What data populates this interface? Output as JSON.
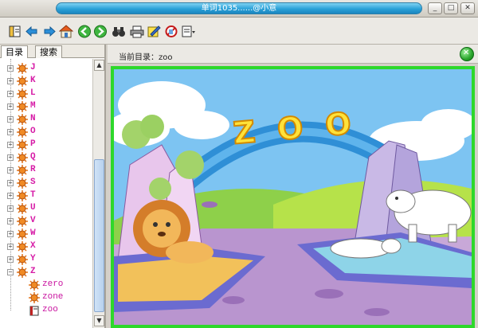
{
  "window": {
    "title": "单词1035......@小意",
    "controls": [
      "minimize",
      "maximize",
      "close"
    ],
    "control_glyphs": [
      "_",
      "□",
      "✕"
    ]
  },
  "toolbar": {
    "buttons": [
      {
        "name": "contents-icon"
      },
      {
        "name": "back-arrow-icon"
      },
      {
        "name": "forward-arrow-icon"
      },
      {
        "name": "home-icon"
      },
      {
        "name": "previous-green-icon"
      },
      {
        "name": "next-green-icon"
      },
      {
        "name": "find-binoculars-icon"
      },
      {
        "name": "print-icon"
      },
      {
        "name": "options-icon"
      },
      {
        "name": "stop-icon"
      },
      {
        "name": "menu-dropdown-icon"
      }
    ]
  },
  "sidebar": {
    "tabs": [
      "目录",
      "搜索"
    ],
    "active_tab": 0,
    "letters": [
      "J",
      "K",
      "L",
      "M",
      "N",
      "O",
      "P",
      "Q",
      "R",
      "S",
      "T",
      "U",
      "V",
      "W",
      "X",
      "Y",
      "Z"
    ],
    "expanded_letter": "Z",
    "expanded_items": [
      "zero",
      "zone",
      "zoo"
    ],
    "selected_item": "zoo"
  },
  "content": {
    "path_label": "当前目录：zoo",
    "picture_title": "ZOO",
    "colors": {
      "frame": "#2ed82b",
      "label": "#d61aa6",
      "title_bar": "#2aa1d8"
    }
  }
}
